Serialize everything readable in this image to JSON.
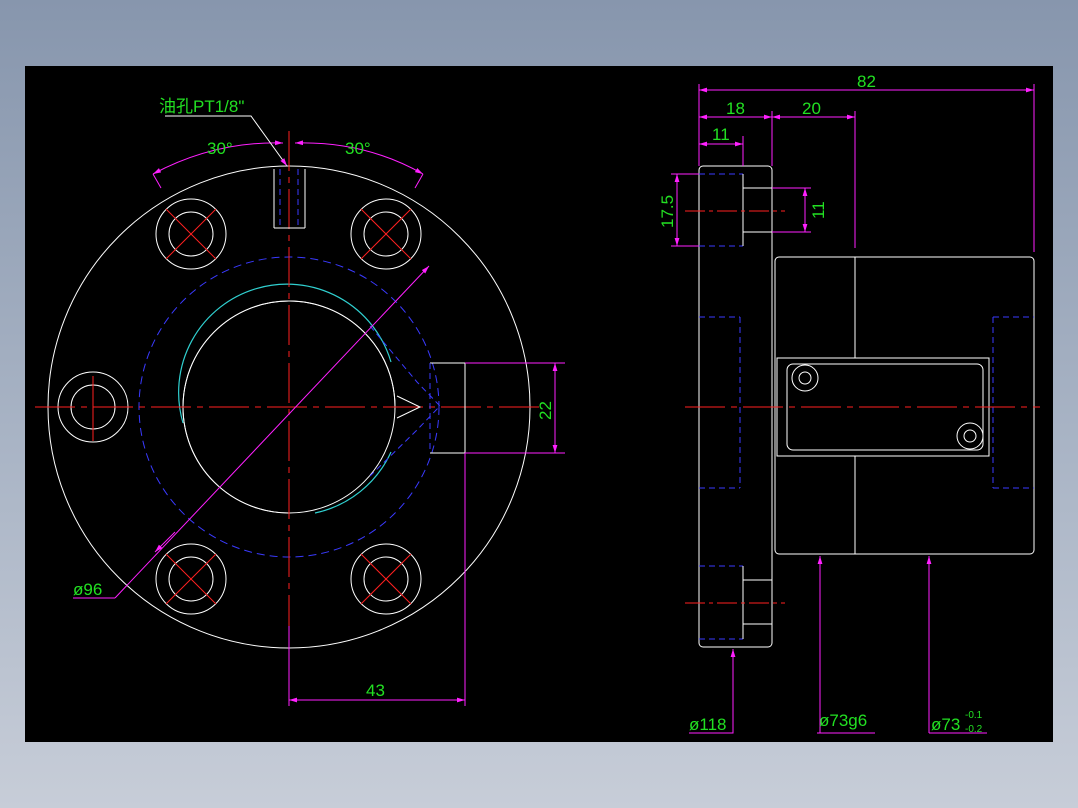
{
  "colors": {
    "background": "#000000",
    "outline": "#ffffff",
    "centerline": "#ff2020",
    "hidden": "#3a3aff",
    "dimension": "#ff20ff",
    "text": "#22e022",
    "cyan": "#30d0d0"
  },
  "front_view": {
    "oil_hole_label": "油孔PT1/8\"",
    "angle_left": "30°",
    "angle_right": "30°",
    "pcd_label": "ø96",
    "offset_dim": "43",
    "port_dim": "22"
  },
  "side_view": {
    "overall_length": "82",
    "flange_width": "18",
    "step_length": "20",
    "counterbore_depth": "11",
    "counterbore_diameter": "17.5",
    "hole_diameter": "11",
    "flange_od": "ø118",
    "body_od_fit": "ø73g6",
    "body_od_base": "ø73",
    "tol_upper": "-0.1",
    "tol_lower": "-0.2"
  }
}
